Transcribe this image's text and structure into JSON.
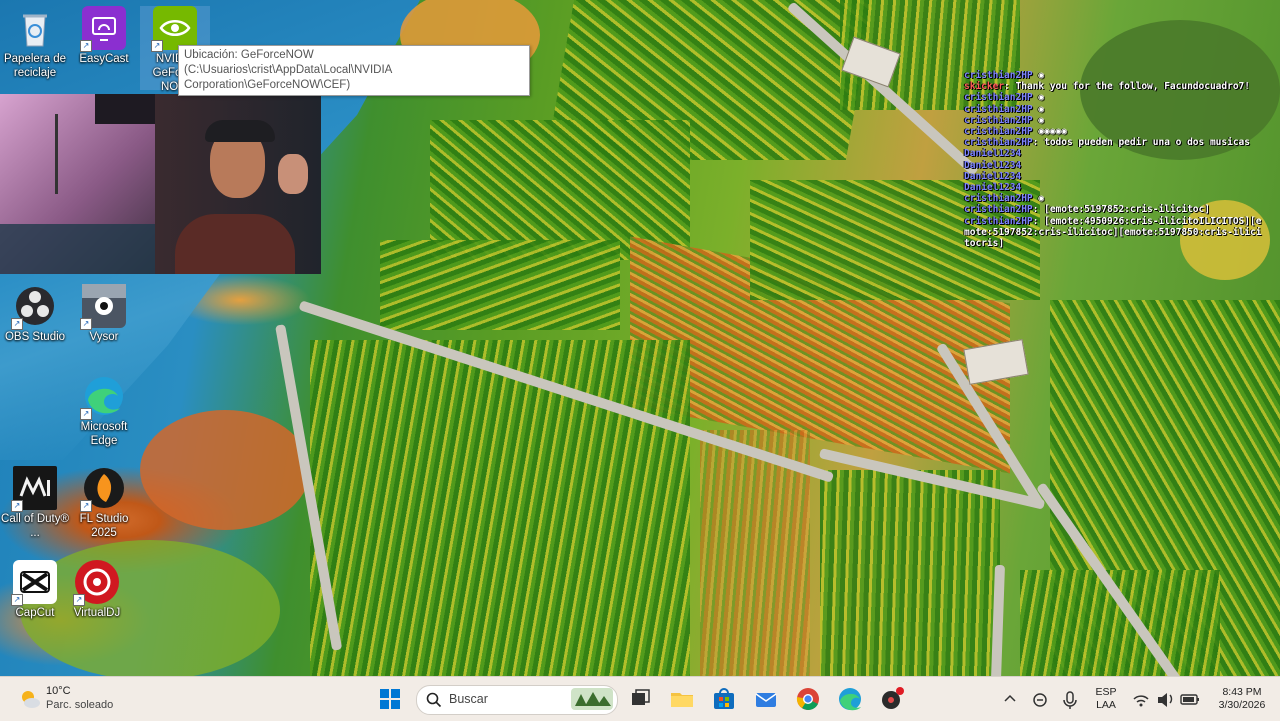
{
  "desktop": {
    "icons": [
      {
        "label": "Papelera de reciclaje",
        "icon": "recycle-bin-icon"
      },
      {
        "label": "EasyCast",
        "icon": "easycast-icon"
      },
      {
        "label": "NVIDIA GeForce NOW",
        "icon": "geforce-now-icon"
      },
      {
        "label": "OBS Studio",
        "icon": "obs-icon"
      },
      {
        "label": "Vysor",
        "icon": "vysor-icon"
      },
      {
        "label": "Microsoft Edge",
        "icon": "edge-icon"
      },
      {
        "label": "Call of Duty® ...",
        "icon": "call-of-duty-icon"
      },
      {
        "label": "FL Studio 2025",
        "icon": "fl-studio-icon"
      },
      {
        "label": "CapCut",
        "icon": "capcut-icon"
      },
      {
        "label": "VirtualDJ",
        "icon": "virtualdj-icon"
      }
    ]
  },
  "tooltip": {
    "text": "Ubicación: GeForceNOW (C:\\Usuarios\\crist\\AppData\\Local\\NVIDIA Corporation\\GeForceNOW\\CEF)"
  },
  "chat": {
    "lines": [
      {
        "user": "cristhian2HP",
        "text": ""
      },
      {
        "user": "skicker",
        "text": "Thank you for the follow, Facundocuadro7!"
      },
      {
        "user": "cristhian2HP",
        "text": ""
      },
      {
        "user": "cristhian2HP",
        "text": ""
      },
      {
        "user": "cristhian2HP",
        "text": ""
      },
      {
        "user": "cristhian2HP",
        "text": ""
      },
      {
        "user": "cristhian2HP",
        "text": "todos pueden pedir una o dos musicas"
      },
      {
        "user": "Daniel1234",
        "text": ""
      },
      {
        "user": "Daniel1234",
        "text": ""
      },
      {
        "user": "Daniel1234",
        "text": ""
      },
      {
        "user": "Daniel1234",
        "text": ""
      },
      {
        "user": "cristhian2HP",
        "text": ""
      },
      {
        "user": "cristhian2HP",
        "text": "[emote:5197852:cris-ilicitoc]"
      },
      {
        "user": "cristhian2HP",
        "text": "[emote:4950926:cris-ilicitoILICITOS][emote:5197852:cris-ilicitoc][emote:5197850:cris-ilicitocris]"
      }
    ]
  },
  "taskbar": {
    "weather_temp": "10°C",
    "weather_desc": "Parc. soleado",
    "search_placeholder": "Buscar",
    "lang_top": "ESP",
    "lang_bottom": "LAA",
    "time": "8:43 PM",
    "date": "3/30/2026"
  },
  "colors": {
    "taskbar_bg": "#f2ece6",
    "chat_user": "#7d84ff",
    "accent": "#0078d4"
  }
}
